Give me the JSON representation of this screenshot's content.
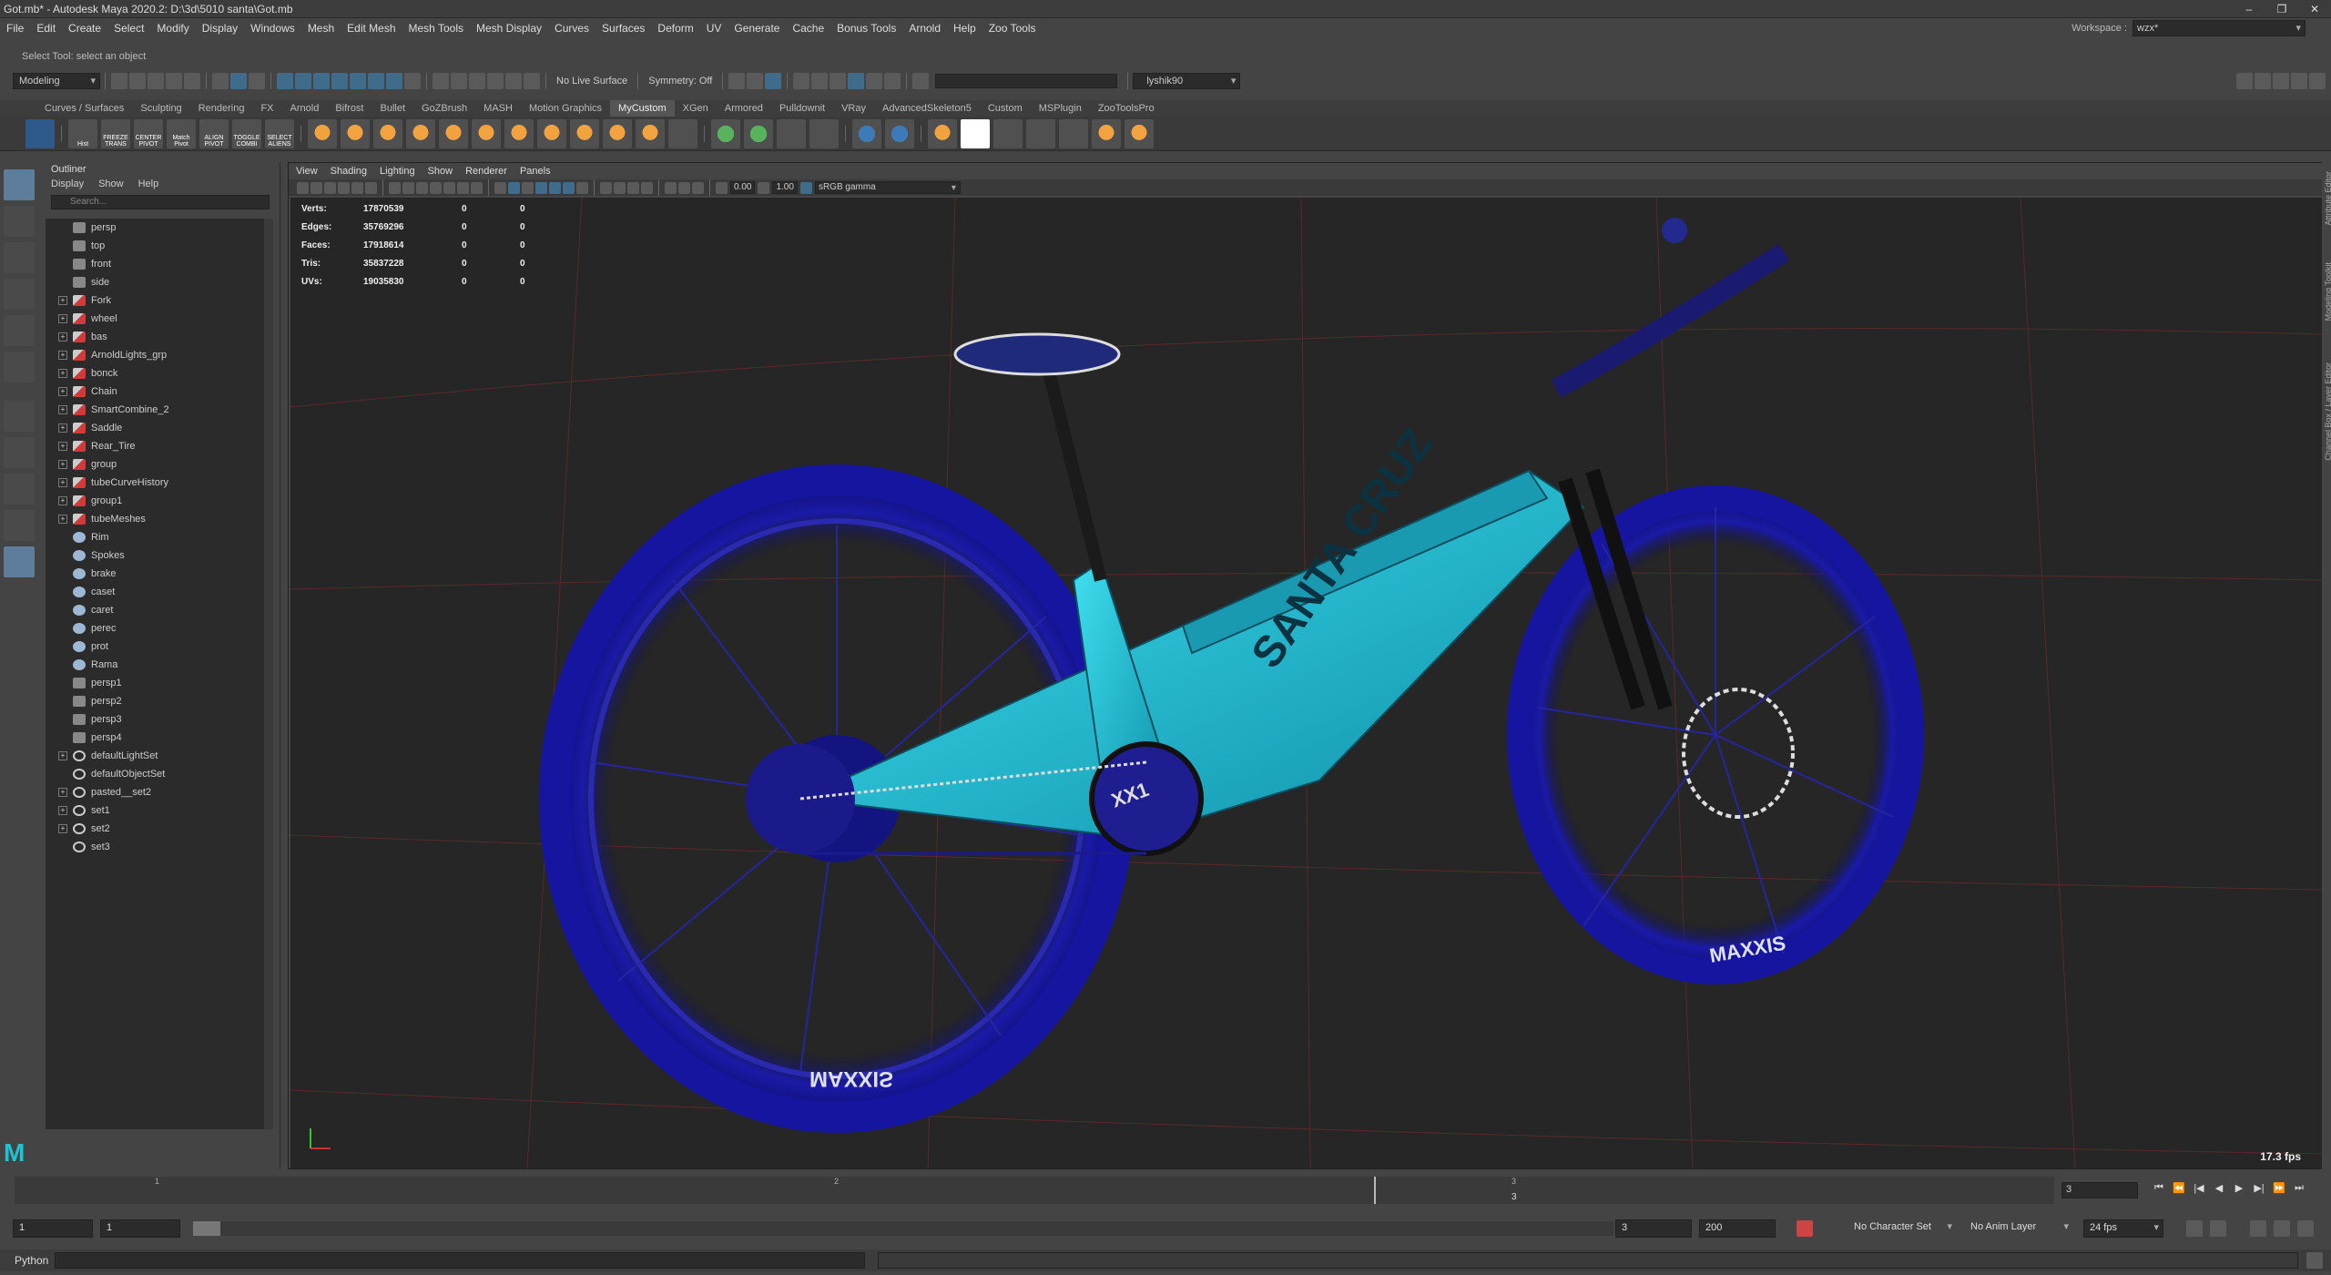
{
  "title": "Got.mb* - Autodesk Maya 2020.2: D:\\3d\\5010 santa\\Got.mb",
  "window_controls": [
    "–",
    "❐",
    "✕"
  ],
  "menus": [
    "File",
    "Edit",
    "Create",
    "Select",
    "Modify",
    "Display",
    "Windows",
    "Mesh",
    "Edit Mesh",
    "Mesh Tools",
    "Mesh Display",
    "Curves",
    "Surfaces",
    "Deform",
    "UV",
    "Generate",
    "Cache",
    "Bonus Tools",
    "Arnold",
    "Help",
    "Zoo Tools"
  ],
  "workspace": {
    "label": "Workspace :",
    "value": "wzx*"
  },
  "statusline": {
    "menuset": "Modeling",
    "live": "No Live Surface",
    "symmetry": "Symmetry: Off",
    "user": "lyshik90"
  },
  "help_line": "Select Tool: select an object",
  "shelf_tabs": [
    "Curves / Surfaces",
    "Sculpting",
    "Rendering",
    "FX",
    "Arnold",
    "Bifrost",
    "Bullet",
    "GoZBrush",
    "MASH",
    "Motion Graphics",
    "MyCustom",
    "XGen",
    "Armored",
    "Pulldownit",
    "VRay",
    "AdvancedSkeleton5",
    "Custom",
    "MSPlugin",
    "ZooToolsPro"
  ],
  "active_shelf": "MyCustom",
  "shelf_items": [
    {
      "label": "Hist",
      "style": ""
    },
    {
      "label": "FREEZE TRANS",
      "style": ""
    },
    {
      "label": "CENTER PIVOT",
      "style": ""
    },
    {
      "label": "Match Pivot",
      "style": ""
    },
    {
      "label": "ALIGN PIVOT",
      "style": ""
    },
    {
      "label": "TOGGLE COMBI",
      "style": ""
    },
    {
      "label": "SELECT ALIENS",
      "style": ""
    }
  ],
  "outliner": {
    "title": "Outliner",
    "menu": [
      "Display",
      "Show",
      "Help"
    ],
    "search_placeholder": "Search...",
    "items": [
      {
        "name": "persp",
        "icon": "cam",
        "exp": false
      },
      {
        "name": "top",
        "icon": "cam",
        "exp": false
      },
      {
        "name": "front",
        "icon": "cam",
        "exp": false
      },
      {
        "name": "side",
        "icon": "cam",
        "exp": false
      },
      {
        "name": "Fork",
        "icon": "grp",
        "exp": true
      },
      {
        "name": "wheel",
        "icon": "grp",
        "exp": true
      },
      {
        "name": "bas",
        "icon": "grp",
        "exp": true
      },
      {
        "name": "ArnoldLights_grp",
        "icon": "grp",
        "exp": true
      },
      {
        "name": "bonck",
        "icon": "grp",
        "exp": true
      },
      {
        "name": "Chain",
        "icon": "grp",
        "exp": true
      },
      {
        "name": "SmartCombine_2",
        "icon": "grp",
        "exp": true
      },
      {
        "name": "Saddle",
        "icon": "grp",
        "exp": true
      },
      {
        "name": "Rear_Tire",
        "icon": "grp",
        "exp": true
      },
      {
        "name": "group",
        "icon": "grp",
        "exp": true
      },
      {
        "name": "tubeCurveHistory",
        "icon": "grp",
        "exp": true
      },
      {
        "name": "group1",
        "icon": "grp",
        "exp": true
      },
      {
        "name": "tubeMeshes",
        "icon": "grp",
        "exp": true
      },
      {
        "name": "Rim",
        "icon": "mesh",
        "exp": false
      },
      {
        "name": "Spokes",
        "icon": "mesh",
        "exp": false
      },
      {
        "name": "brake",
        "icon": "mesh",
        "exp": false
      },
      {
        "name": "caset",
        "icon": "mesh",
        "exp": false
      },
      {
        "name": "caret",
        "icon": "mesh",
        "exp": false
      },
      {
        "name": "perec",
        "icon": "mesh",
        "exp": false
      },
      {
        "name": "prot",
        "icon": "mesh",
        "exp": false
      },
      {
        "name": "Rama",
        "icon": "mesh",
        "exp": false
      },
      {
        "name": "persp1",
        "icon": "cam",
        "exp": false
      },
      {
        "name": "persp2",
        "icon": "cam",
        "exp": false
      },
      {
        "name": "persp3",
        "icon": "cam",
        "exp": false
      },
      {
        "name": "persp4",
        "icon": "cam",
        "exp": false
      },
      {
        "name": "defaultLightSet",
        "icon": "set",
        "exp": true
      },
      {
        "name": "defaultObjectSet",
        "icon": "set",
        "exp": false
      },
      {
        "name": "pasted__set2",
        "icon": "set",
        "exp": true
      },
      {
        "name": "set1",
        "icon": "set",
        "exp": true
      },
      {
        "name": "set2",
        "icon": "set",
        "exp": true
      },
      {
        "name": "set3",
        "icon": "set",
        "exp": false
      }
    ]
  },
  "viewport": {
    "menu": [
      "View",
      "Shading",
      "Lighting",
      "Show",
      "Renderer",
      "Panels"
    ],
    "exposure": "0.00",
    "gamma": "1.00",
    "colorspace": "sRGB gamma",
    "hud": [
      {
        "label": "Verts:",
        "a": "17870539",
        "b": "0",
        "c": "0"
      },
      {
        "label": "Edges:",
        "a": "35769296",
        "b": "0",
        "c": "0"
      },
      {
        "label": "Faces:",
        "a": "17918614",
        "b": "0",
        "c": "0"
      },
      {
        "label": "Tris:",
        "a": "35837228",
        "b": "0",
        "c": "0"
      },
      {
        "label": "UVs:",
        "a": "19035830",
        "b": "0",
        "c": "0"
      }
    ],
    "fps": "17.3 fps",
    "brand_downtube": "SANTA CRUZ",
    "brand_tire": "MAXXIS",
    "drivetrain_label": "XX1"
  },
  "timeline": {
    "ticks": [
      "1",
      "2",
      "3"
    ],
    "current": "3",
    "current_field": "3"
  },
  "range": {
    "start": "1",
    "start2": "1",
    "end": "3",
    "end2": "200",
    "character": "No Character Set",
    "anim_layer": "No Anim Layer",
    "fps": "24 fps"
  },
  "playback": [
    "⏮",
    "⏪",
    "|◀",
    "◀",
    "▶",
    "▶|",
    "⏩",
    "⏭"
  ],
  "cmd": {
    "label": "Python"
  },
  "side_tabs": [
    "Attribute Editor",
    "Modeling Toolkit",
    "Channel Box / Layer Editor"
  ],
  "colors": {
    "frame": "#1ec4d4",
    "wire": "#1a1ab0",
    "tire": "#15159a",
    "grid": "#5a2a2a"
  }
}
